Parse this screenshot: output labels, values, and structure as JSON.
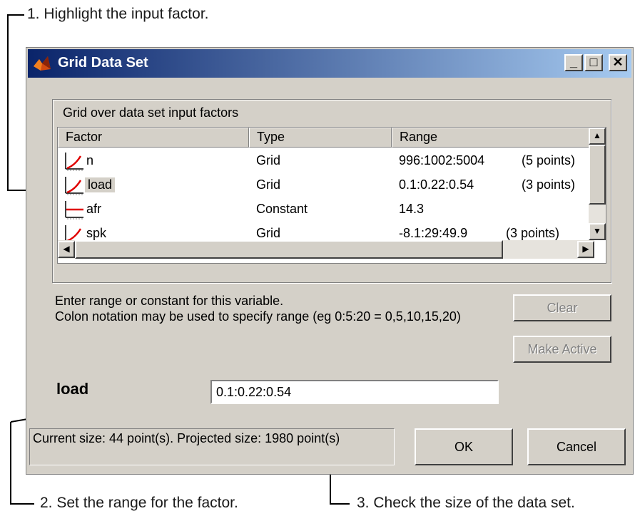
{
  "callouts": {
    "step1": "1. Highlight the input factor.",
    "step2": "2. Set the range for the factor.",
    "step3": "3. Check the size of the data set."
  },
  "window": {
    "title": "Grid Data Set",
    "icon": "matlab-logo-icon",
    "controls": {
      "minimize": "_",
      "maximize": "□",
      "close": "✕"
    }
  },
  "group": {
    "label": "Grid over data set input factors",
    "columns": [
      "Factor",
      "Type",
      "Range"
    ],
    "rows": [
      {
        "icon": "grid-curve-icon",
        "factor": "n",
        "type": "Grid",
        "range": "996:1002:5004",
        "points": "(5 points)"
      },
      {
        "icon": "grid-curve-icon",
        "factor": "load",
        "type": "Grid",
        "range": "0.1:0.22:0.54",
        "points": "(3 points)",
        "selected": true
      },
      {
        "icon": "constant-line-icon",
        "factor": "afr",
        "type": "Constant",
        "range": "14.3",
        "points": ""
      },
      {
        "icon": "grid-curve-icon",
        "factor": "spk",
        "type": "Grid",
        "range": "-8.1:29:49.9",
        "points": "(3 points)"
      }
    ]
  },
  "help": {
    "line1": "Enter range or constant for this variable.",
    "line2": "Colon notation may be used to specify range (eg 0:5:20 = 0,5,10,15,20)"
  },
  "buttons": {
    "clear": "Clear",
    "make_active": "Make Active",
    "ok": "OK",
    "cancel": "Cancel"
  },
  "editor": {
    "factor_label": "load",
    "range_value": "0.1:0.22:0.54"
  },
  "status": {
    "text": "Current size: 44 point(s).  Projected size: 1980 point(s)"
  }
}
